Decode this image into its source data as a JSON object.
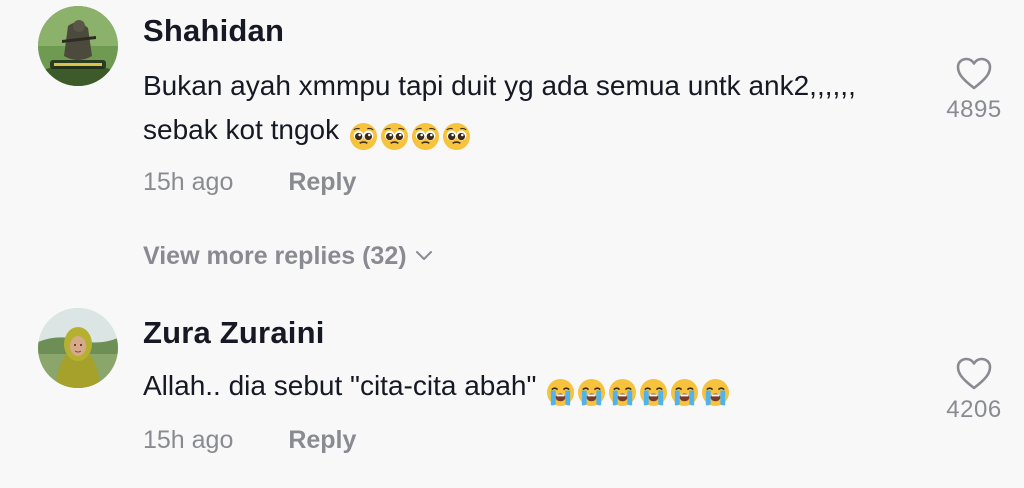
{
  "comments": [
    {
      "username": "Shahidan",
      "text": "Bukan ayah xmmpu tapi duit yg ada semua untk ank2,,,,,, sebak kot tngok",
      "emojis": [
        "pleading-face-emoji",
        "pleading-face-emoji",
        "pleading-face-emoji",
        "pleading-face-emoji"
      ],
      "time": "15h ago",
      "reply_label": "Reply",
      "likes": "4895",
      "view_more_replies": "View more replies (32)"
    },
    {
      "username": "Zura Zuraini",
      "text": "Allah.. dia sebut \"cita-cita abah\"",
      "emojis": [
        "loudly-crying-face-emoji",
        "loudly-crying-face-emoji",
        "loudly-crying-face-emoji",
        "loudly-crying-face-emoji",
        "loudly-crying-face-emoji",
        "loudly-crying-face-emoji"
      ],
      "time": "15h ago",
      "reply_label": "Reply",
      "likes": "4206"
    }
  ],
  "colors": {
    "background": "#f8f8f8",
    "primary_text": "#161823",
    "secondary_text": "#8a8b91"
  },
  "icons": {
    "like": "heart-outline-icon",
    "expand": "chevron-down-icon"
  }
}
